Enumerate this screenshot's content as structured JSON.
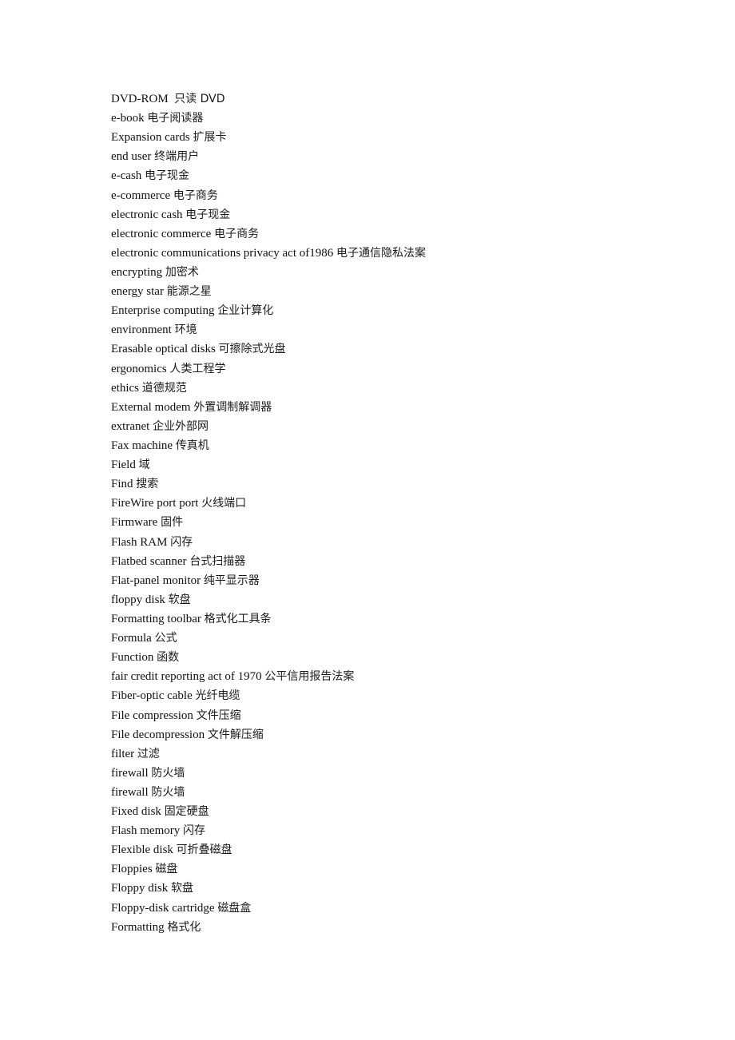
{
  "document": {
    "entries": [
      {
        "en": "DVD-ROM ",
        "zh": "只读 DVD"
      },
      {
        "en": "e-book",
        "zh": "电子阅读器"
      },
      {
        "en": "Expansion cards",
        "zh": "扩展卡"
      },
      {
        "en": "end user",
        "zh": "终端用户"
      },
      {
        "en": "e-cash",
        "zh": "电子现金"
      },
      {
        "en": "e-commerce",
        "zh": "电子商务"
      },
      {
        "en": "electronic cash",
        "zh": "电子现金"
      },
      {
        "en": "electronic commerce",
        "zh": "电子商务"
      },
      {
        "en": "electronic communications privacy act of1986",
        "zh": "电子通信隐私法案"
      },
      {
        "en": "encrypting",
        "zh": "加密术"
      },
      {
        "en": "energy star",
        "zh": "能源之星"
      },
      {
        "en": "Enterprise computing",
        "zh": "企业计算化"
      },
      {
        "en": "environment",
        "zh": "环境"
      },
      {
        "en": "Erasable optical disks",
        "zh": "可擦除式光盘"
      },
      {
        "en": "ergonomics",
        "zh": "人类工程学"
      },
      {
        "en": "ethics",
        "zh": "道德规范"
      },
      {
        "en": "External modem",
        "zh": "外置调制解调器"
      },
      {
        "en": "extranet",
        "zh": "企业外部网"
      },
      {
        "en": "Fax machine",
        "zh": "传真机"
      },
      {
        "en": "Field",
        "zh": "域"
      },
      {
        "en": "Find",
        "zh": "搜索"
      },
      {
        "en": "FireWire port port",
        "zh": "火线端口"
      },
      {
        "en": "Firmware",
        "zh": "固件"
      },
      {
        "en": "Flash RAM",
        "zh": "闪存"
      },
      {
        "en": "Flatbed scanner",
        "zh": "台式扫描器"
      },
      {
        "en": "Flat-panel monitor",
        "zh": "纯平显示器"
      },
      {
        "en": "floppy disk",
        "zh": "软盘"
      },
      {
        "en": "Formatting toolbar",
        "zh": "格式化工具条"
      },
      {
        "en": "Formula",
        "zh": "公式"
      },
      {
        "en": "Function",
        "zh": "函数"
      },
      {
        "en": "fair credit reporting act of 1970",
        "zh": "公平信用报告法案"
      },
      {
        "en": "Fiber-optic cable",
        "zh": "光纤电缆"
      },
      {
        "en": "File compression",
        "zh": "文件压缩"
      },
      {
        "en": "File decompression",
        "zh": "文件解压缩"
      },
      {
        "en": "filter",
        "zh": "过滤"
      },
      {
        "en": "firewall",
        "zh": "防火墙"
      },
      {
        "en": "firewall",
        "zh": "防火墙"
      },
      {
        "en": "Fixed disk",
        "zh": "固定硬盘"
      },
      {
        "en": "Flash memory",
        "zh": "闪存"
      },
      {
        "en": "Flexible disk",
        "zh": "可折叠磁盘"
      },
      {
        "en": "Floppies",
        "zh": "磁盘"
      },
      {
        "en": "Floppy disk",
        "zh": "软盘"
      },
      {
        "en": "Floppy-disk cartridge",
        "zh": "磁盘盒"
      },
      {
        "en": "Formatting",
        "zh": "格式化"
      }
    ]
  }
}
